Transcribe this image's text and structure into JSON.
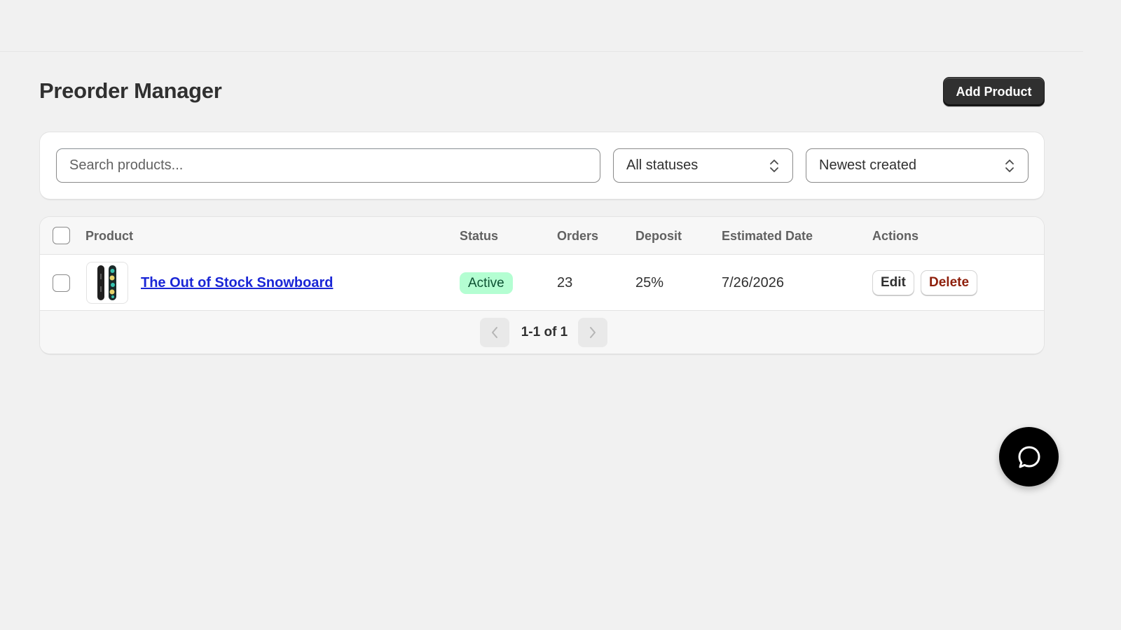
{
  "page": {
    "title": "Preorder Manager",
    "add_button": "Add Product"
  },
  "filters": {
    "search_placeholder": "Search products...",
    "status_selected": "All statuses",
    "sort_selected": "Newest created"
  },
  "table": {
    "columns": {
      "product": "Product",
      "status": "Status",
      "orders": "Orders",
      "deposit": "Deposit",
      "estimated_date": "Estimated Date",
      "actions": "Actions"
    },
    "rows": [
      {
        "name": "The Out of Stock Snowboard",
        "status": "Active",
        "orders": "23",
        "deposit": "25%",
        "estimated_date": "7/26/2026",
        "edit_label": "Edit",
        "delete_label": "Delete"
      }
    ]
  },
  "pagination": {
    "label": "1-1 of 1"
  },
  "colors": {
    "primary_button": "#303030",
    "link": "#1a26d6",
    "badge_active_bg": "#b4fed2",
    "delete_text": "#8e1f0b"
  },
  "icons": {
    "select_chevron": "chevron-updown-icon",
    "prev": "chevron-left-icon",
    "next": "chevron-right-icon",
    "chat": "chat-bubble-icon"
  }
}
